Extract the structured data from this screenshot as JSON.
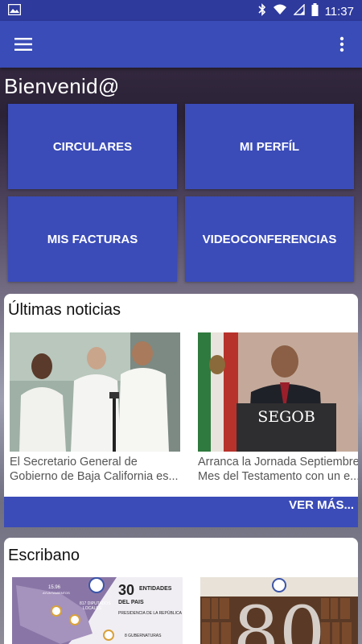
{
  "status_bar": {
    "time": "11:37",
    "icons": [
      "image-icon",
      "bluetooth-icon",
      "wifi-icon",
      "signal-icon",
      "battery-icon"
    ]
  },
  "app_bar": {
    "menu_icon": "hamburger-menu-icon",
    "overflow_icon": "more-vert-icon",
    "color": "#3a4cb7"
  },
  "welcome": "Bienvenid@",
  "tiles": [
    {
      "label": "CIRCULARES"
    },
    {
      "label": "MI PERFÍL"
    },
    {
      "label": "MIS FACTURAS"
    },
    {
      "label": "VIDEOCONFERENCIAS"
    }
  ],
  "news": {
    "title": "Últimas noticias",
    "items": [
      {
        "line1": "El Secretario General de",
        "line2": "Gobierno de Baja California es..."
      },
      {
        "line1": "Arranca la Jornada Septiembre",
        "line2": "Mes del Testamento con un e...",
        "image_sign": "SEGOB"
      }
    ],
    "more_label": "VER MÁS..."
  },
  "notaries": {
    "title": "Escribano",
    "image_left": {
      "big_num": "30",
      "big_label": "ENTIDADES",
      "big_label2": "DEL PAIS",
      "line1": "15.96",
      "line2": "AYUNTAMIENTOS",
      "line3": "817 DIPUTADOS",
      "line4": "LOCALES",
      "line5": "PRESIDENCIA DE LA REPÚBLICA",
      "line6": "8 GUBERNATURAS"
    },
    "image_right": {
      "big_text": "80"
    }
  },
  "accent_color": "#3b4cb8"
}
